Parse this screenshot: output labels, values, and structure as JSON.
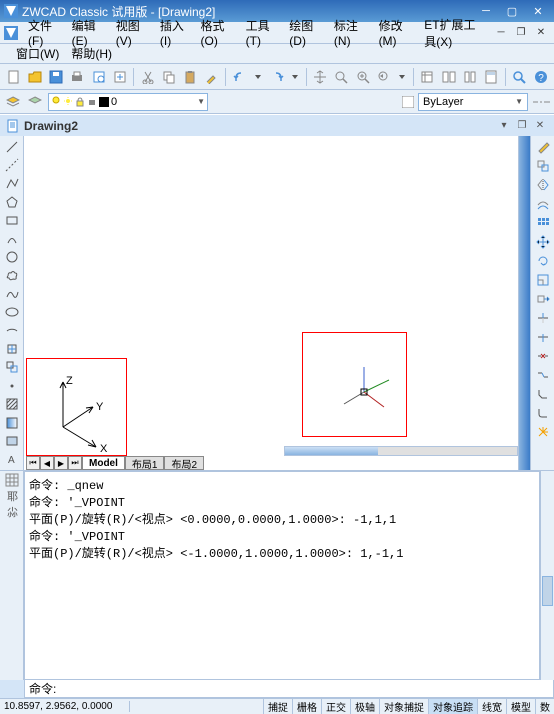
{
  "titlebar": {
    "title": "ZWCAD Classic 试用版 - [Drawing2]"
  },
  "menus": {
    "file": "文件(F)",
    "edit": "编辑(E)",
    "view": "视图(V)",
    "insert": "插入(I)",
    "format": "格式(O)",
    "tools": "工具(T)",
    "draw": "绘图(D)",
    "dim": "标注(N)",
    "modify": "修改(M)",
    "ext": "ET扩展工具(X)",
    "window": "窗口(W)",
    "help": "帮助(H)"
  },
  "layerbar": {
    "layer0": "0",
    "bylayer": "ByLayer"
  },
  "doc": {
    "title": "Drawing2"
  },
  "tabs": {
    "model": "Model",
    "layout1": "布局1",
    "layout2": "布局2"
  },
  "cmd": {
    "history": "命令: _qnew\n命令: '_VPOINT\n平面(P)/旋转(R)/<视点> <0.0000,0.0000,1.0000>: -1,1,1\n命令: '_VPOINT\n平面(P)/旋转(R)/<视点> <-1.0000,1.0000,1.0000>: 1,-1,1",
    "prompt": "命令:"
  },
  "ucs": {
    "x": "X",
    "y": "Y",
    "z": "Z"
  },
  "status": {
    "coords": "10.8597, 2.9562, 0.0000",
    "snap": "捕捉",
    "grid": "栅格",
    "ortho": "正交",
    "polar": "极轴",
    "osnap": "对象捕捉",
    "otrack": "对象追踪",
    "lwt": "线宽",
    "model": "模型",
    "num": "数"
  }
}
